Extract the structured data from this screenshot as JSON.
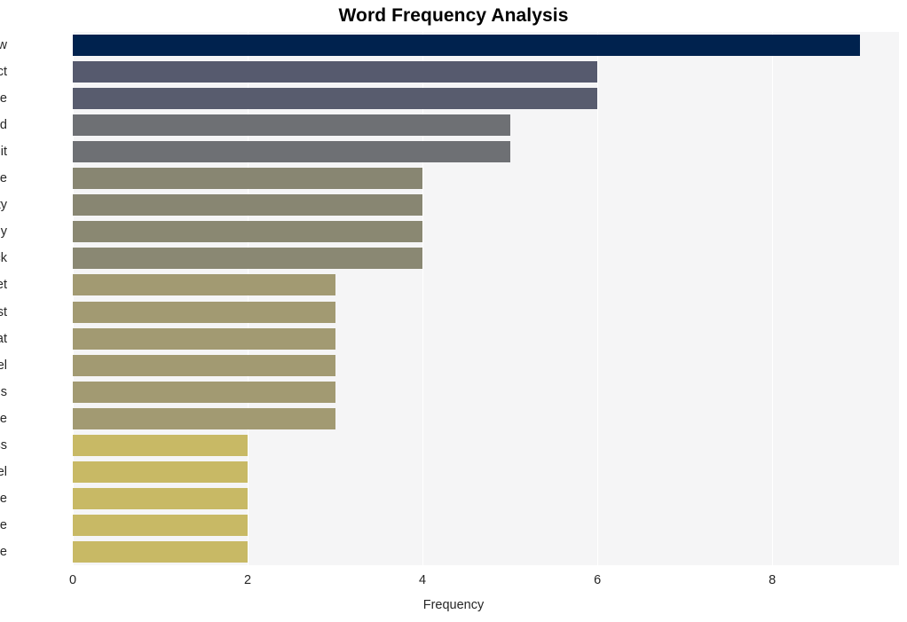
{
  "chart_data": {
    "type": "bar",
    "orientation": "horizontal",
    "title": "Word Frequency Analysis",
    "xlabel": "Frequency",
    "ylabel": "",
    "xlim": [
      0,
      9.45
    ],
    "ylim": [
      0,
      20
    ],
    "xticks": [
      "0",
      "2",
      "4",
      "6",
      "8"
    ],
    "xtick_values": [
      0,
      2,
      4,
      6,
      8
    ],
    "grid": "vertical-white",
    "legend": "none",
    "categories": [
      "flaw",
      "impact",
      "cve",
      "android",
      "exploit",
      "google",
      "security",
      "company",
      "attack",
      "target",
      "august",
      "threat",
      "pixel",
      "devices",
      "privilege",
      "address",
      "kernel",
      "case",
      "remote",
      "code"
    ],
    "values": [
      9,
      6,
      6,
      5,
      5,
      4,
      4,
      4,
      4,
      3,
      3,
      3,
      3,
      3,
      3,
      2,
      2,
      2,
      2,
      2
    ],
    "bar_colors": [
      "#00224e",
      "#565a6e",
      "#585c6e",
      "#6e7074",
      "#6e7074",
      "#888672",
      "#888672",
      "#8a8872",
      "#8a8873",
      "#a29a72",
      "#a29a72",
      "#a29a72",
      "#a29a72",
      "#a29a72",
      "#a29a72",
      "#c8b965",
      "#c8b965",
      "#c8b965",
      "#c8b965",
      "#c8b965"
    ],
    "colormap": "cividis",
    "plot_background": "#f5f5f6",
    "gridline_color": "#ffffff",
    "figure_background": "#ffffff",
    "text_color": "#262626",
    "title_color": "#000000"
  }
}
